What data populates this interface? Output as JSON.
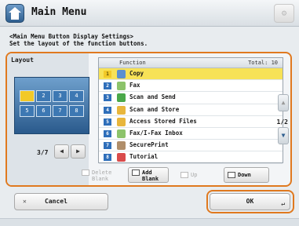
{
  "window": {
    "title": "Main Menu",
    "title_button_icon": "settings-icon"
  },
  "instructions": {
    "line1": "<Main Menu Button Display Settings>",
    "line2": "Set the layout of the function buttons."
  },
  "layout": {
    "label": "Layout",
    "preview_cells": [
      "",
      "2",
      "3",
      "4",
      "5",
      "6",
      "7",
      "8"
    ],
    "active_cell": 0,
    "page": "3/7",
    "prev_label": "◀",
    "next_label": "▶"
  },
  "function_list": {
    "column_header": "Function",
    "total": "Total: 10",
    "selected_index": 0,
    "rows": [
      {
        "num": "1",
        "label": "Copy",
        "icon": "copy-icon",
        "color": "#5a8fd0"
      },
      {
        "num": "2",
        "label": "Fax",
        "icon": "fax-icon",
        "color": "#8cc36b"
      },
      {
        "num": "3",
        "label": "Scan and Send",
        "icon": "scan-send-icon",
        "color": "#4aa84a"
      },
      {
        "num": "4",
        "label": "Scan and Store",
        "icon": "scan-store-icon",
        "color": "#e8b63c"
      },
      {
        "num": "5",
        "label": "Access Stored Files",
        "icon": "stored-files-icon",
        "color": "#e8b63c"
      },
      {
        "num": "6",
        "label": "Fax/I-Fax Inbox",
        "icon": "inbox-icon",
        "color": "#8cc36b"
      },
      {
        "num": "7",
        "label": "SecurePrint",
        "icon": "secure-print-icon",
        "color": "#b08e6a"
      },
      {
        "num": "8",
        "label": "Tutorial",
        "icon": "tutorial-icon",
        "color": "#d94b4b"
      }
    ],
    "scroll_page": "1/2",
    "scroll_up": "▲",
    "scroll_down": "▼"
  },
  "actions": {
    "delete_blank": "Delete\nBlank",
    "add_blank": "Add\nBlank",
    "up": "Up",
    "down": "Down"
  },
  "footer": {
    "cancel": "Cancel",
    "ok": "OK"
  },
  "colors": {
    "accent": "#e0791f",
    "selected_row": "#f7e257",
    "number_badge": "#2f6fba"
  }
}
